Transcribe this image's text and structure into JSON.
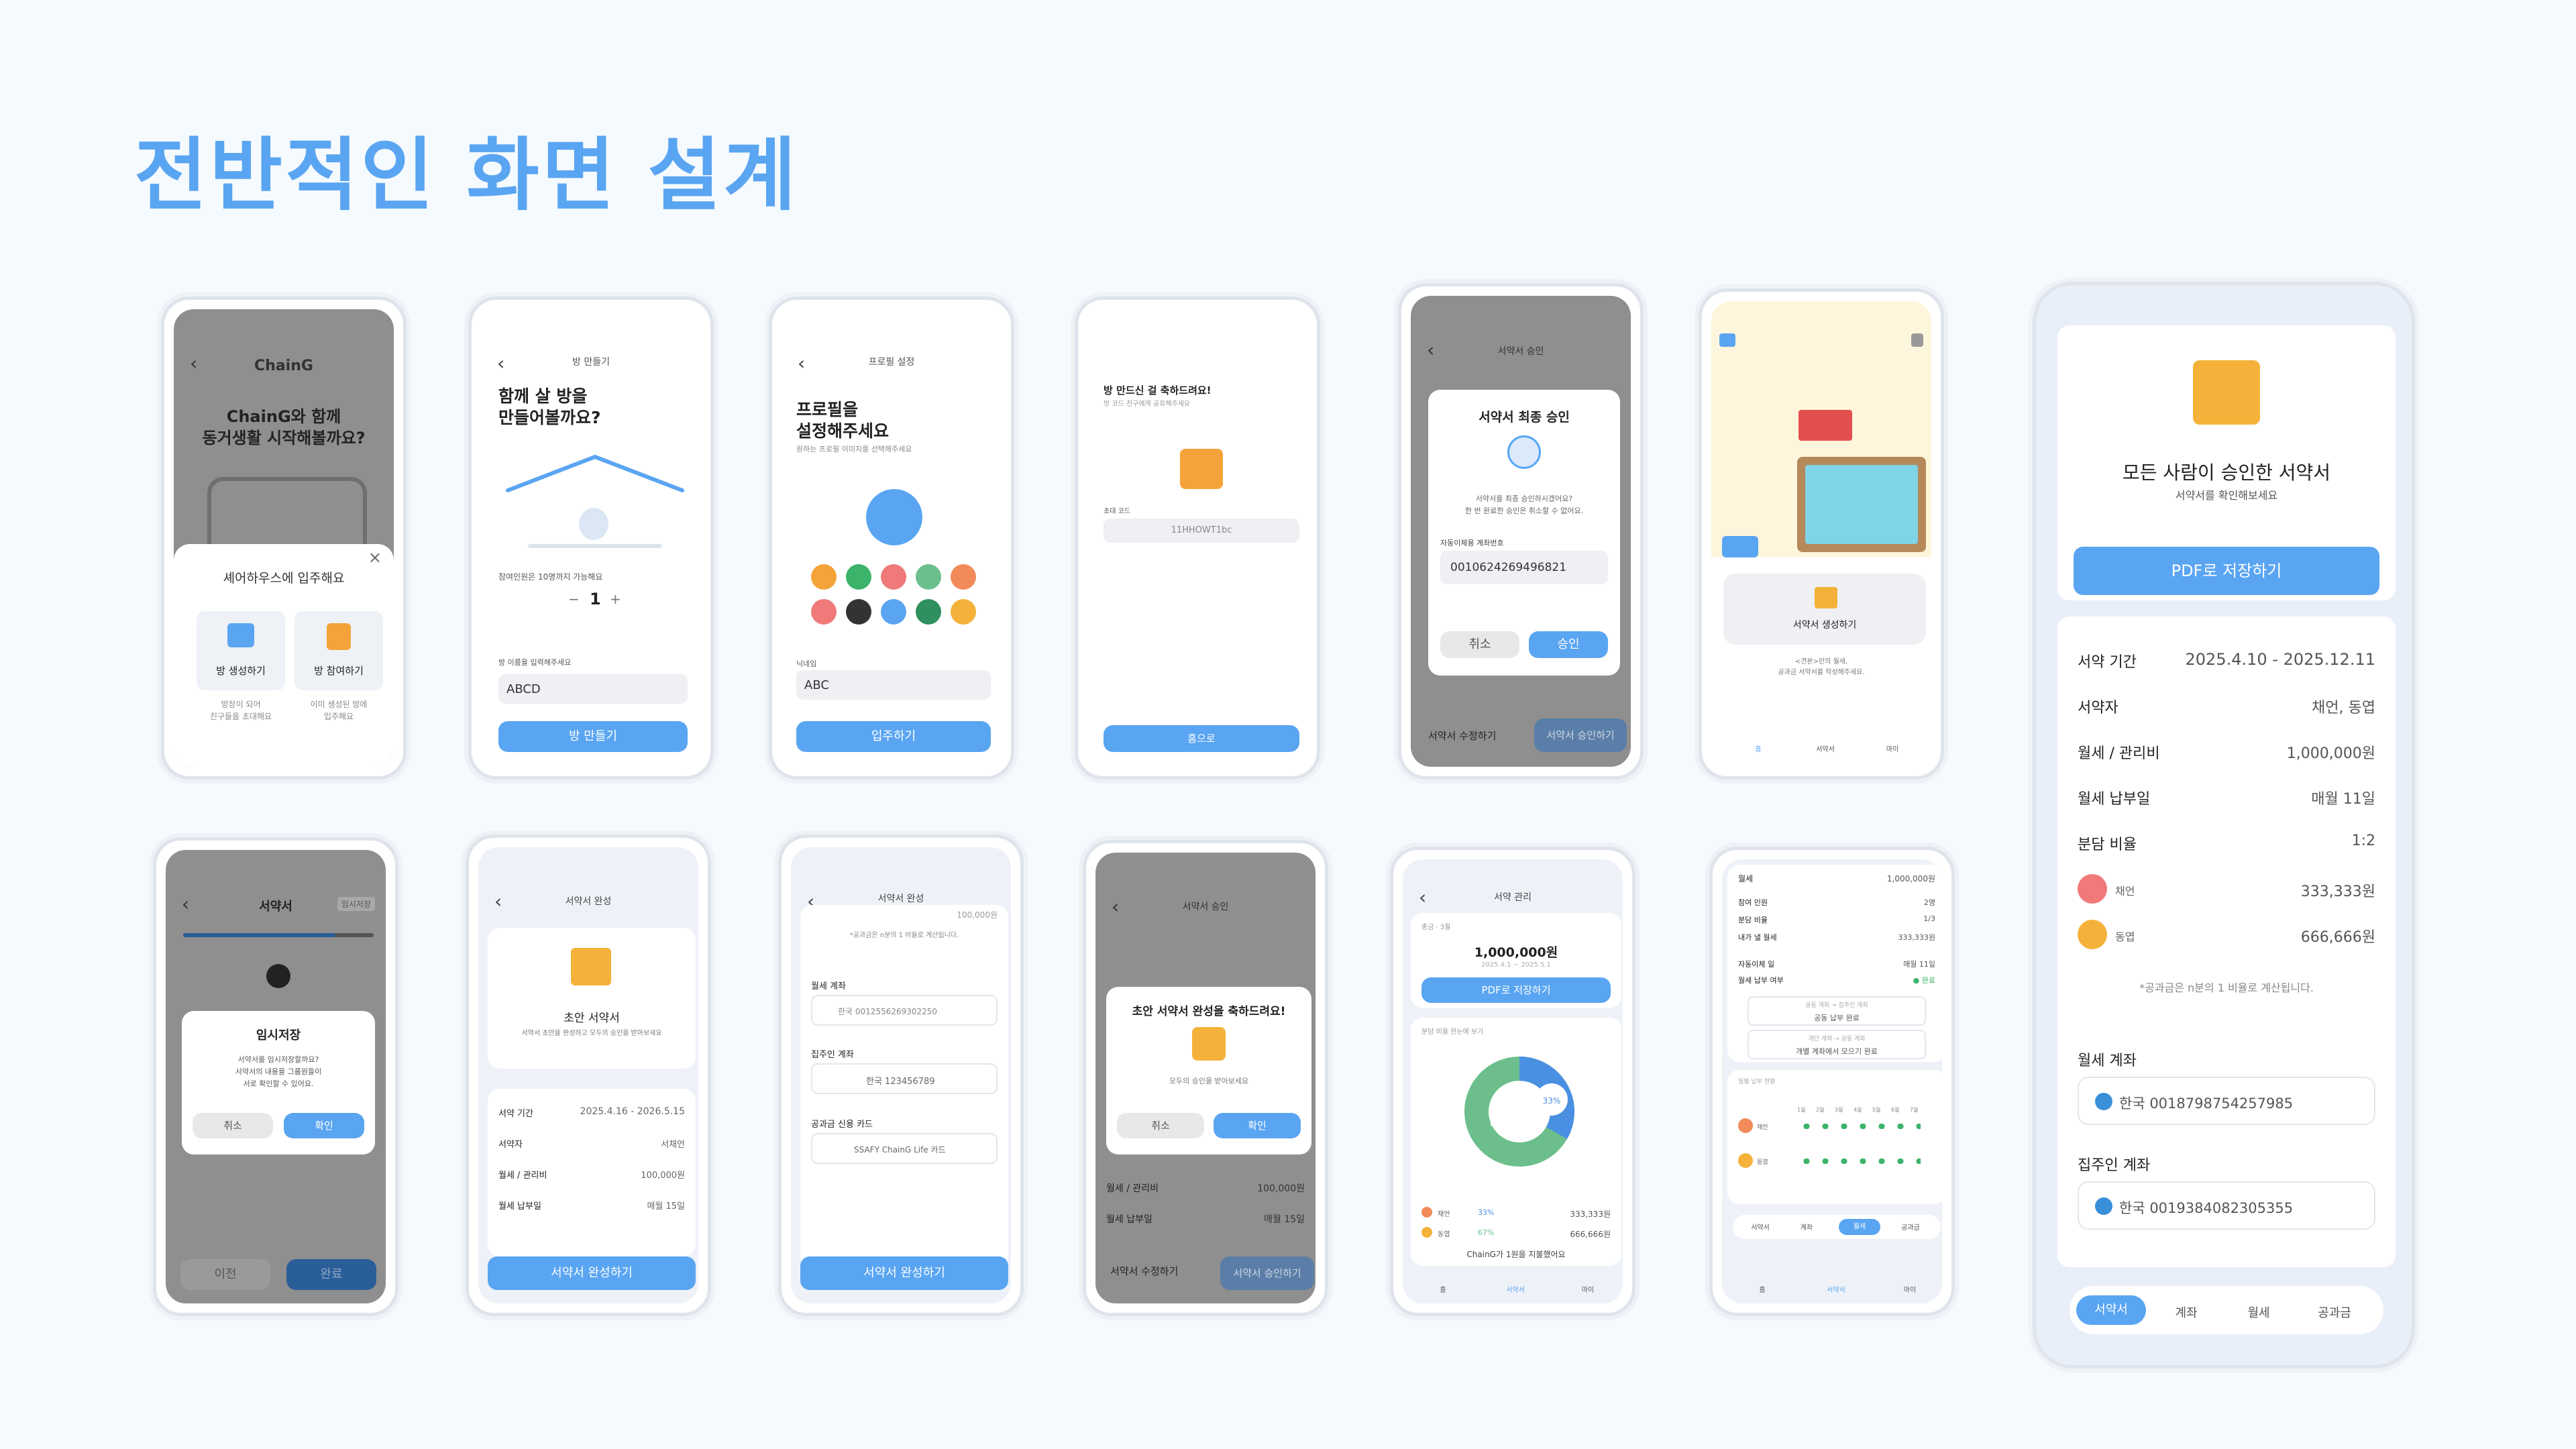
{
  "page_title": "전반적인 화면 설계",
  "s1": {
    "logo": "ChainG",
    "headline1": "ChainG와 함께",
    "headline2": "동거생활 시작해볼까요?",
    "sheet_title": "셰어하우스에 입주해요",
    "close": "×",
    "opt1_label": "방 생성하기",
    "opt1_desc1": "방장이 되어",
    "opt1_desc2": "친구들을 초대해요",
    "opt2_label": "방 참여하기",
    "opt2_desc1": "이미 생성된 방에",
    "opt2_desc2": "입주해요"
  },
  "s2": {
    "header": "방 만들기",
    "head1": "함께 살 방을",
    "head2": "만들어볼까요?",
    "count_label": "참여인원은 10명까지 가능해요",
    "count_minus": "−",
    "count_value": "1",
    "count_plus": "+",
    "name_label": "방 이름을 입력해주세요",
    "name_value": "ABCD",
    "button": "방 만들기"
  },
  "s3": {
    "header": "프로필 설정",
    "head1": "프로필을",
    "head2": "설정해주세요",
    "sub": "원하는 프로필 이미지를 선택해주세요",
    "nick_label": "닉네임",
    "nick_value": "ABC",
    "button": "입주하기"
  },
  "s4": {
    "head": "방 만드신 걸 축하드려요!",
    "sub": "방 코드 친구에게 공유해주세요",
    "code_label": "초대 코드",
    "code_value": "11HHOWT1bc",
    "button": "홈으로"
  },
  "s5": {
    "header": "서약서 승인",
    "modal_title": "서약서 최종 승인",
    "modal_desc1": "서약서를 최종 승인하시겠어요?",
    "modal_desc2": "한 번 완료한 승인은 취소할 수 없어요.",
    "acct_label": "자동이체용 계좌번호",
    "acct_value": "0010624269496821",
    "cancel": "취소",
    "ok": "승인",
    "bottom_left": "서약서 수정하기",
    "bottom_right": "서약서 승인하기"
  },
  "s6": {
    "card_title": "서약서 생성하기",
    "card_desc1": "<견본>만의 월세,",
    "card_desc2": "공과금 서약서를 작성해주세요.",
    "tab_labels": [
      "홈",
      "서약서",
      "마이"
    ]
  },
  "s7": {
    "head": "모든 사람이 승인한 서약서",
    "sub": "서약서를 확인해보세요",
    "pdf_button": "PDF로 저장하기",
    "rows": [
      {
        "label": "서약 기간",
        "value": "2025.4.10 - 2025.12.11"
      },
      {
        "label": "서약자",
        "value": "채언, 동엽"
      },
      {
        "label": "월세 / 관리비",
        "value": "1,000,000원"
      },
      {
        "label": "월세 납부일",
        "value": "매월 11일"
      },
      {
        "label": "분담 비율",
        "value": "1:2"
      }
    ],
    "people": [
      {
        "name": "채언",
        "value": "333,333원"
      },
      {
        "name": "동엽",
        "value": "666,666원"
      }
    ],
    "note": "*공과금은 n분의 1 비율로 계산됩니다.",
    "rent_acct_label": "월세 계좌",
    "rent_acct": "한국 0018798754257985",
    "owner_acct_label": "집주인 계좌",
    "owner_acct": "한국 0019384082305355",
    "tabs": [
      "서약서",
      "계좌",
      "월세",
      "공과금"
    ]
  },
  "s8": {
    "header": "서약서",
    "temp": "임시저장",
    "progress": "80%",
    "modal_title": "임시저장",
    "modal_desc1": "서약서를 임시저장할까요?",
    "modal_desc2": "서약서의 내용을 그룹원들이",
    "modal_desc3": "서로 확인할 수 있어요.",
    "cancel": "취소",
    "ok": "확인",
    "prev": "이전",
    "done": "완료"
  },
  "s9": {
    "header": "서약서 완성",
    "card_title": "초안 서약서",
    "card_sub": "서약서 초안을 완성하고 모두의 승인을 받아보세요",
    "rows": [
      {
        "label": "서약 기간",
        "value": "2025.4.16 - 2026.5.15"
      },
      {
        "label": "서약자",
        "value": "서채언"
      },
      {
        "label": "월세 / 관리비",
        "value": "100,000원"
      },
      {
        "label": "월세 납부일",
        "value": "매월 15일"
      }
    ],
    "button": "서약서 완성하기"
  },
  "s10": {
    "header": "서약서 완성",
    "top_value": "100,000원",
    "note": "*공과금은 n분의 1 비율로 계산됩니다.",
    "rent_label": "월세 계좌",
    "rent_value": "한국 0012556269302250",
    "owner_label": "집주인 계좌",
    "owner_value": "한국 123456789",
    "card_label": "공과금 신용 카드",
    "card_value": "SSAFY ChainG Life 카드",
    "button": "서약서 완성하기"
  },
  "s11": {
    "header": "서약서 승인",
    "modal_title": "초안 서약서 완성을 축하드려요!",
    "modal_desc": "모두의 승인을 받아보세요",
    "cancel": "취소",
    "ok": "확인",
    "rows": [
      {
        "label": "월세 / 관리비",
        "value": "100,000원"
      },
      {
        "label": "월세 납부일",
        "value": "매월 15일"
      }
    ],
    "bottom_left": "서약서 수정하기",
    "bottom_right": "서약서 승인하기"
  },
  "s12": {
    "header": "서약 관리",
    "sum_label": "총금 · 3월",
    "amount": "1,000,000원",
    "period": "2025.4.1 ~ 2025.5.1",
    "pdf": "PDF로 저장하기",
    "chart_label": "분담 비율 한눈에 보기",
    "pct_small": "33%",
    "pct_big": "67%",
    "bubble": "동엽\n33%",
    "legend": [
      {
        "name": "채언",
        "pct": "33%",
        "value": "333,333원"
      },
      {
        "name": "동엽",
        "pct": "67%",
        "value": "666,666원"
      }
    ],
    "footer": "ChainG가 1원을 지불했어요",
    "tabs": [
      "홈",
      "서약서",
      "마이"
    ]
  },
  "s13": {
    "rows": [
      {
        "label": "월세",
        "value": "1,000,000원"
      },
      {
        "label": "참여 인원",
        "value": "2명"
      },
      {
        "label": "분담 비율",
        "value": "1/3"
      },
      {
        "label": "내가 낼 월세",
        "value": "333,333원"
      },
      {
        "label": "자동이체 일",
        "value": "매월 11일"
      },
      {
        "label": "월세 납부 여부",
        "value": "● 완료"
      }
    ],
    "box1_top": "공동 계좌 → 집주인 계좌",
    "box1_bottom": "공동 납부 완료",
    "box2_top": "개인 계좌 → 공동 계좌",
    "box2_bottom": "개별 계좌에서 모으기 완료",
    "track_label": "월별 납부 현황",
    "months": [
      "1월",
      "2월",
      "3월",
      "4월",
      "5월",
      "6월",
      "7월"
    ],
    "people": [
      "채언",
      "동엽"
    ],
    "tabs": [
      "서약서",
      "계좌",
      "월세",
      "공과금"
    ],
    "nav": [
      "홈",
      "서약서",
      "마이"
    ]
  },
  "colors": {
    "accent": "#5aa5f2",
    "background": "#f5fafe",
    "green": "#3bb36b"
  }
}
